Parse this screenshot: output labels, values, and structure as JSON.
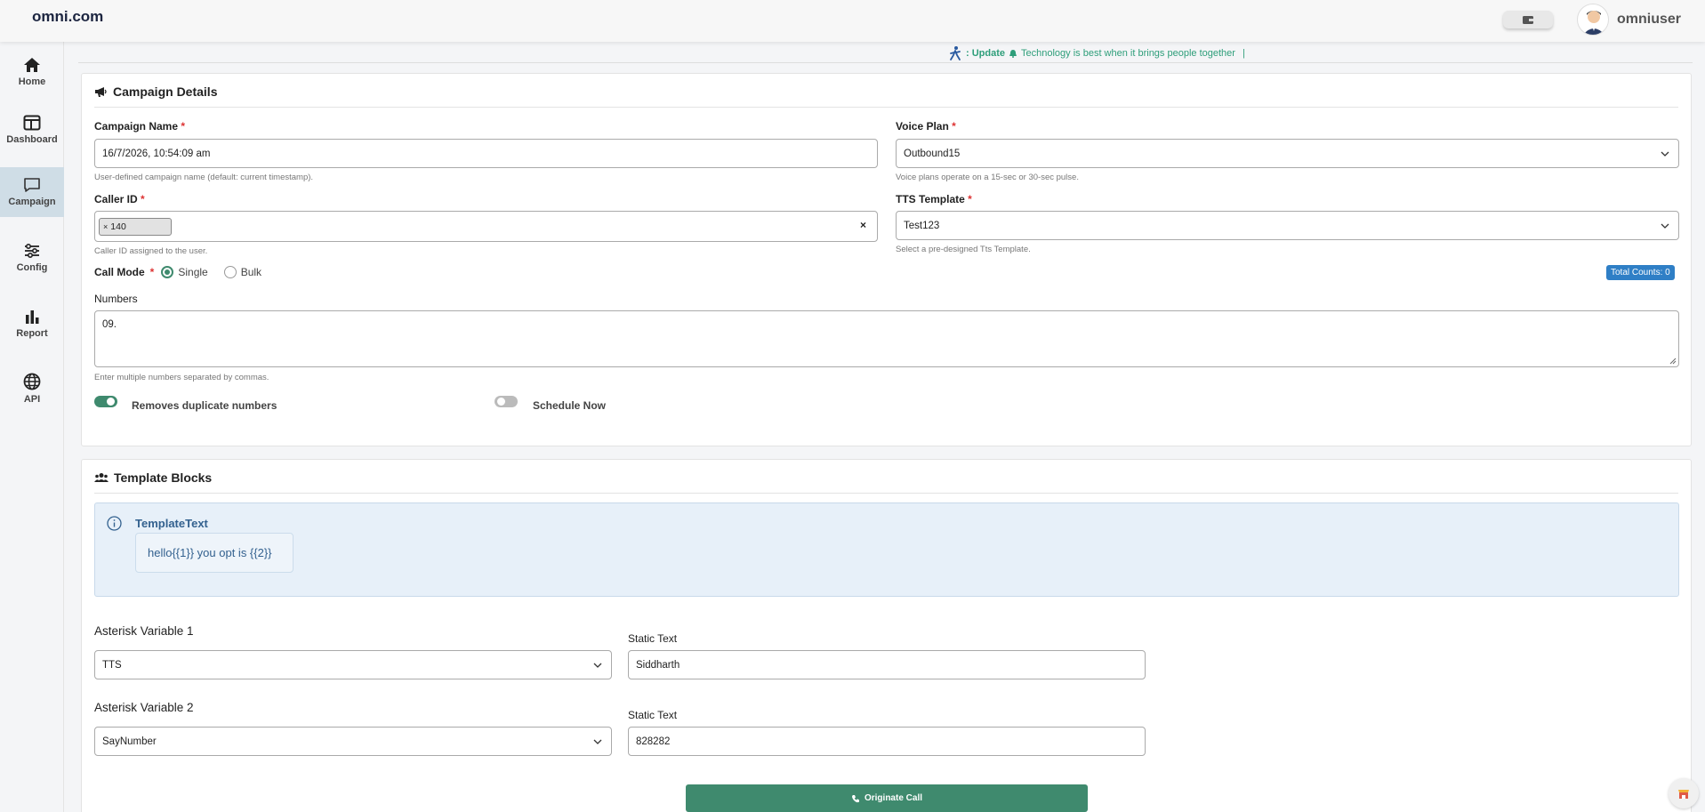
{
  "header": {
    "brand": "omni.com",
    "username": "omniuser"
  },
  "sidebar": {
    "items": [
      {
        "label": "Home",
        "icon": "home-icon"
      },
      {
        "label": "Dashboard",
        "icon": "dashboard-icon"
      },
      {
        "label": "Campaign",
        "icon": "chat-icon",
        "active": true
      },
      {
        "label": "Config",
        "icon": "sliders-icon"
      },
      {
        "label": "Report",
        "icon": "bar-chart-icon"
      },
      {
        "label": "API",
        "icon": "globe-icon"
      }
    ]
  },
  "ticker": {
    "prefix": ": Update",
    "message": "Technology is best when it brings people together",
    "cursor": "|"
  },
  "campaign": {
    "title": "Campaign Details",
    "name_label": "Campaign Name",
    "name_value": "16/7/2026, 10:54:09 am",
    "name_hint": "User-defined campaign name (default: current timestamp).",
    "voice_label": "Voice Plan",
    "voice_value": "Outbound15",
    "voice_hint": "Voice plans operate on a 15-sec or 30-sec pulse.",
    "caller_label": "Caller ID",
    "caller_tag": "140",
    "caller_tag_remove": "×",
    "caller_clear": "×",
    "caller_hint": "Caller ID assigned to the user.",
    "tts_label": "TTS Template",
    "tts_value": "Test123",
    "tts_hint": "Select a pre-designed Tts Template.",
    "required_mark": "*",
    "call_mode_label": "Call Mode",
    "mode_single": "Single",
    "mode_bulk": "Bulk",
    "total_counts_label": "Total Counts:",
    "total_counts_value": "0",
    "numbers_label": "Numbers",
    "numbers_value": "09.",
    "numbers_hint": "Enter multiple numbers separated by commas.",
    "dedupe_label": "Removes duplicate numbers",
    "dedupe_on": true,
    "schedule_label": "Schedule Now",
    "schedule_on": false
  },
  "template": {
    "title": "Template Blocks",
    "block_title": "TemplateText",
    "block_text": "hello{{1}} you opt is {{2}}",
    "vars": [
      {
        "label": "Asterisk Variable 1",
        "select": "TTS",
        "static_label": "Static Text",
        "static_value": "Siddharth"
      },
      {
        "label": "Asterisk Variable 2",
        "select": "SayNumber",
        "static_label": "Static Text",
        "static_value": "828282"
      }
    ],
    "submit_label": "Originate Call"
  },
  "colors": {
    "accent": "#3f8a6e",
    "badge": "#2f7fc6",
    "sidebar_active": "#cfdde6"
  }
}
